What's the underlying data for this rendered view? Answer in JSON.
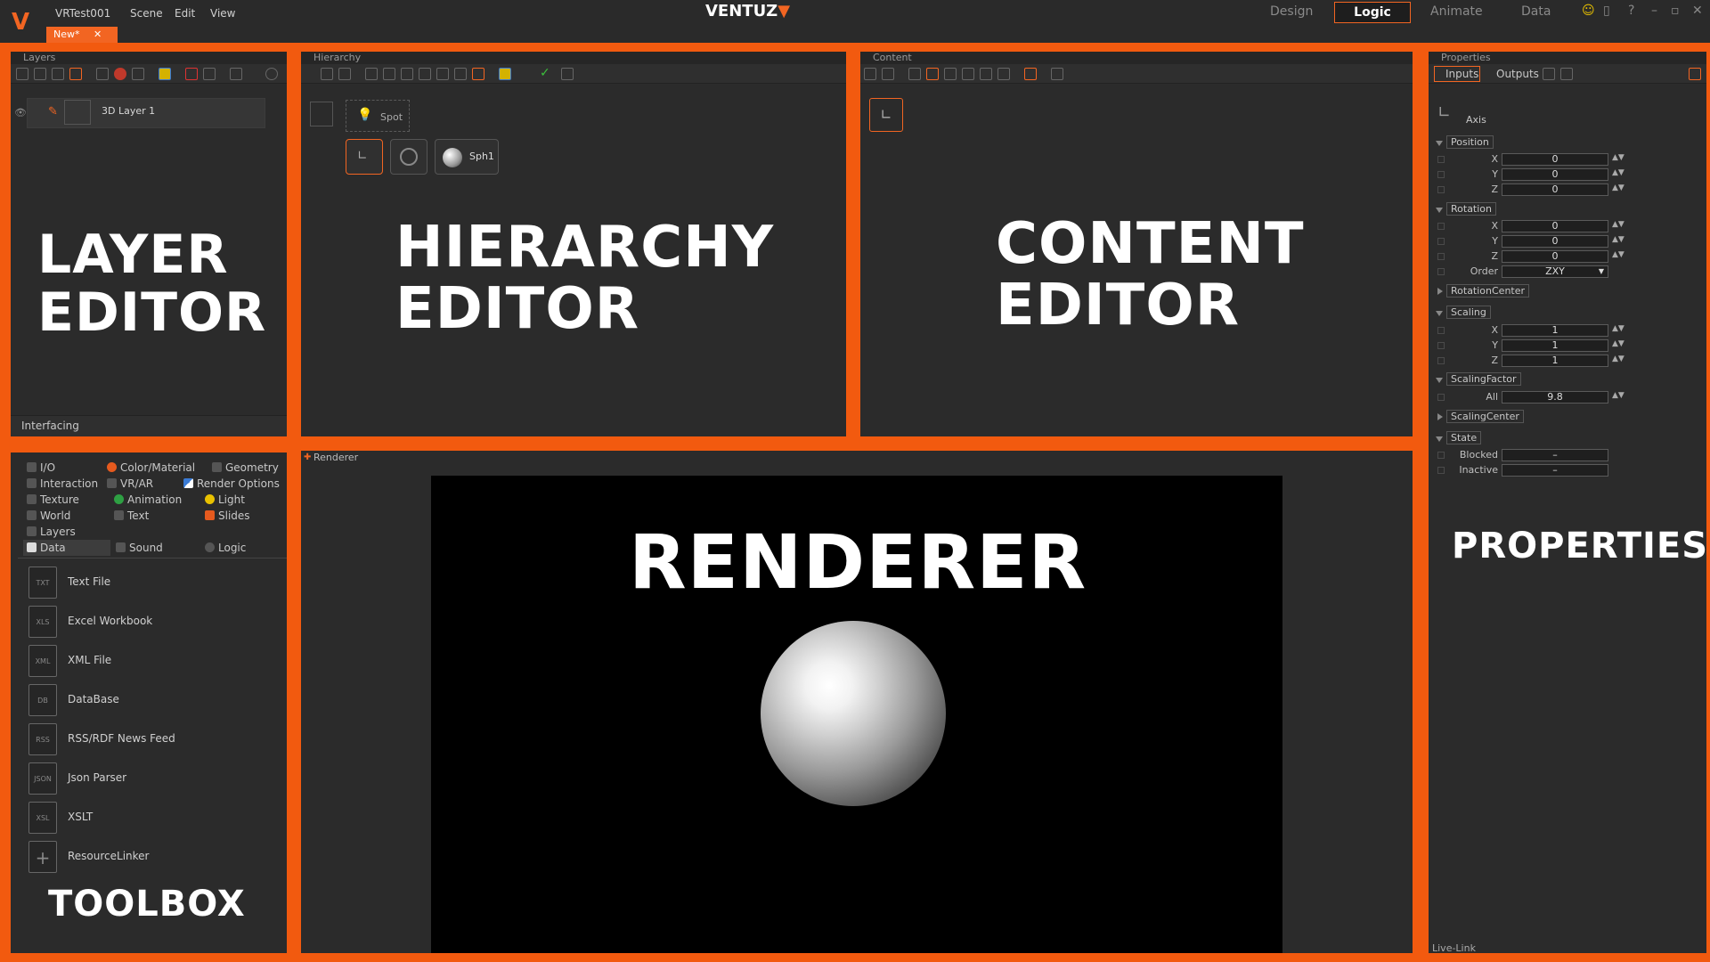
{
  "app": {
    "doc_name": "VRTest001",
    "menu": [
      "Scene",
      "Edit",
      "View"
    ],
    "tab_label": "New*",
    "brand": "VENTUZ",
    "modes": [
      "Design",
      "Logic",
      "Animate",
      "Data"
    ],
    "active_mode": "Logic",
    "accent": "#f26522"
  },
  "layers": {
    "title": "Layers",
    "item_label": "3D Layer 1",
    "footer": "Interfacing",
    "overlay": "LAYER\nEDITOR"
  },
  "hierarchy": {
    "title": "Hierarchy",
    "node_spot": "Spot",
    "node_sphere": "Sph1",
    "overlay": "HIERARCHY\nEDITOR"
  },
  "content": {
    "title": "Content",
    "overlay": "CONTENT\nEDITOR"
  },
  "toolbox": {
    "categories": {
      "io": "I/O",
      "color_material": "Color/Material",
      "geometry": "Geometry",
      "interaction": "Interaction",
      "vr_ar": "VR/AR",
      "render_options": "Render Options",
      "texture": "Texture",
      "animation": "Animation",
      "light": "Light",
      "world": "World",
      "text": "Text",
      "slides": "Slides",
      "layers": "Layers",
      "data": "Data",
      "sound": "Sound",
      "logic": "Logic"
    },
    "items": [
      {
        "icon": "TXT",
        "label": "Text File"
      },
      {
        "icon": "XLS",
        "label": "Excel Workbook"
      },
      {
        "icon": "XML",
        "label": "XML File"
      },
      {
        "icon": "DB",
        "label": "DataBase"
      },
      {
        "icon": "RSS",
        "label": "RSS/RDF News Feed"
      },
      {
        "icon": "JSON",
        "label": "Json Parser"
      },
      {
        "icon": "XSL",
        "label": "XSLT"
      },
      {
        "icon": "+",
        "label": "ResourceLinker"
      }
    ],
    "overlay": "TOOLBOX"
  },
  "renderer": {
    "title": "Renderer",
    "overlay": "RENDERER"
  },
  "properties": {
    "title": "Properties",
    "tab_inputs": "Inputs",
    "tab_outputs": "Outputs",
    "node_name": "Axis",
    "position": {
      "label": "Position",
      "x_label": "X",
      "y_label": "Y",
      "z_label": "Z",
      "x": "0",
      "y": "0",
      "z": "0"
    },
    "rotation": {
      "label": "Rotation",
      "x_label": "X",
      "y_label": "Y",
      "z_label": "Z",
      "x": "0",
      "y": "0",
      "z": "0",
      "order_label": "Order",
      "order": "ZXY"
    },
    "rotation_center": "RotationCenter",
    "scaling": {
      "label": "Scaling",
      "x_label": "X",
      "y_label": "Y",
      "z_label": "Z",
      "x": "1",
      "y": "1",
      "z": "1"
    },
    "scaling_factor": {
      "label": "ScalingFactor",
      "all_label": "All",
      "all": "9.8"
    },
    "scaling_center": "ScalingCenter",
    "state": {
      "label": "State",
      "blocked_label": "Blocked",
      "inactive_label": "Inactive",
      "blocked": "–",
      "inactive": "–"
    },
    "footer": "Live-Link",
    "overlay": "PROPERTIES"
  }
}
